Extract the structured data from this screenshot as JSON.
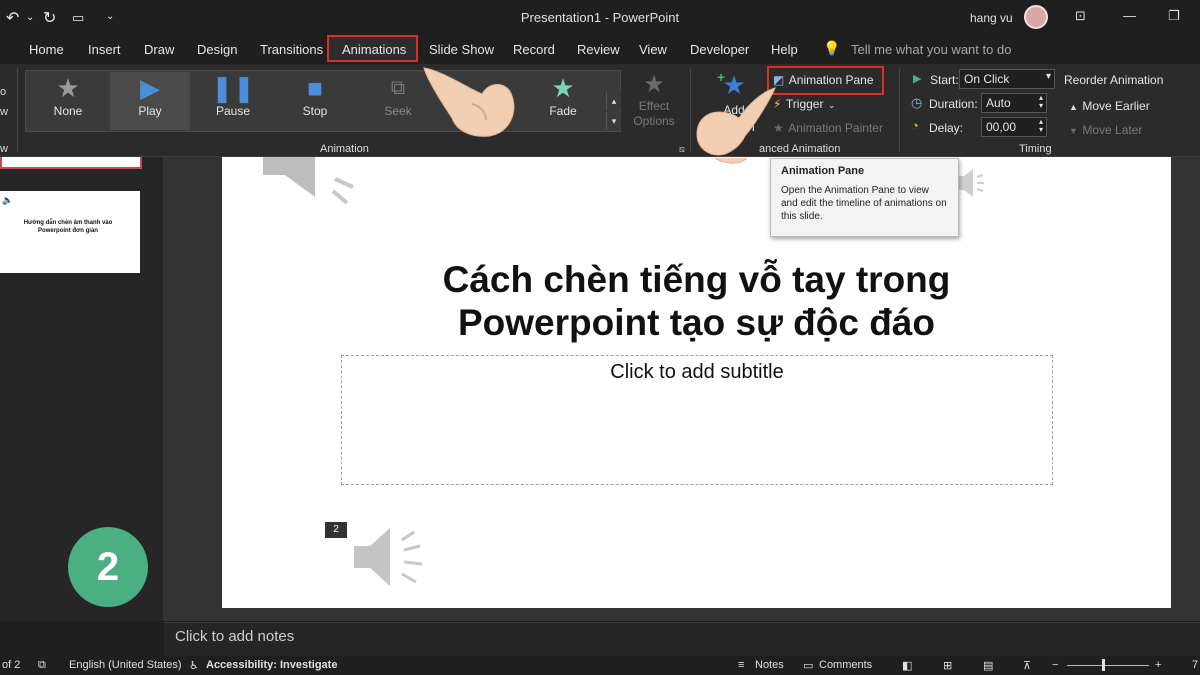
{
  "titlebar": {
    "doc_title": "Presentation1  -  PowerPoint",
    "user_name": "hang vu"
  },
  "tabs": {
    "home": "Home",
    "insert": "Insert",
    "draw": "Draw",
    "design": "Design",
    "transitions": "Transitions",
    "animations": "Animations",
    "slideshow": "Slide Show",
    "record": "Record",
    "review": "Review",
    "view": "View",
    "developer": "Developer",
    "help": "Help",
    "tell_me": "Tell me what you want to do"
  },
  "ribbon": {
    "gallery": [
      {
        "label": "None",
        "icon": "star-outline-icon"
      },
      {
        "label": "Play",
        "icon": "play-icon"
      },
      {
        "label": "Pause",
        "icon": "pause-icon"
      },
      {
        "label": "Stop",
        "icon": "stop-icon"
      },
      {
        "label": "Seek",
        "icon": "seek-icon"
      },
      {
        "label": "Fade",
        "icon": "star-fade-icon"
      }
    ],
    "animation_group": "Animation",
    "effect_options": "Effect\nOptions",
    "add_animation": "Add",
    "add_animation_tail": "n",
    "advanced_group": "anced Animation",
    "animation_pane": "Animation Pane",
    "trigger": "Trigger",
    "animation_painter": "Animation Painter",
    "start_label": "Start:",
    "start_value": "On Click",
    "duration_label": "Duration:",
    "duration_value": "Auto",
    "delay_label": "Delay:",
    "delay_value": "00,00",
    "timing_group": "Timing",
    "reorder": "Reorder Animation",
    "move_earlier": "Move Earlier",
    "move_later": "Move Later"
  },
  "tooltip": {
    "title": "Animation Pane",
    "body": "Open the Animation Pane to view and edit the timeline of animations on this slide."
  },
  "thumbnails": {
    "thumb2_text": "Hướng dẫn chèn âm thanh vào Powerpoint đơn giản"
  },
  "step_badge": "2",
  "slide": {
    "title_line1": "Cách chèn tiếng vỗ tay trong",
    "title_line2": "Powerpoint tạo sự độc đáo",
    "subtitle_placeholder": "Click to add subtitle",
    "slide_number_tag": "2"
  },
  "notes": {
    "placeholder": "Click to add notes"
  },
  "status": {
    "slide_of": "of 2",
    "language": "English (United States)",
    "accessibility": "Accessibility: Investigate",
    "notes": "Notes",
    "comments": "Comments",
    "zoom": "7"
  },
  "colors": {
    "highlight_red": "#d9302c",
    "badge_green": "#4cae83",
    "ribbon_bg": "#2b2b2b"
  }
}
